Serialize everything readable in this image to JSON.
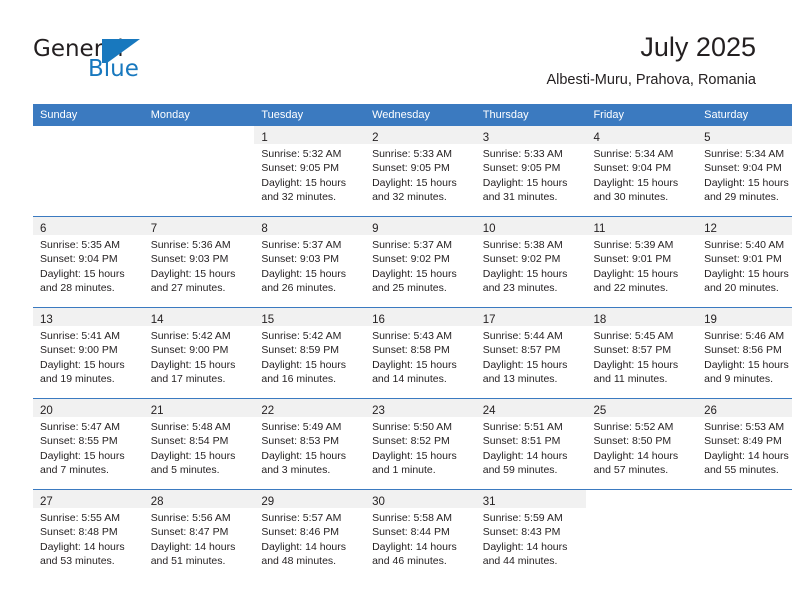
{
  "brand": {
    "word_one": "General",
    "word_two": "Blue",
    "flag_icon": "blue-flag-triangle",
    "colors": {
      "text": "#231f20",
      "blue": "#1878be"
    }
  },
  "header": {
    "title": "July 2025",
    "subtitle": "Albesti-Muru, Prahova, Romania"
  },
  "theme": {
    "header_blue": "#3b7ac0",
    "daynum_band": "#f1f1f1",
    "text": "#231f20"
  },
  "weekday_headers": [
    "Sunday",
    "Monday",
    "Tuesday",
    "Wednesday",
    "Thursday",
    "Friday",
    "Saturday"
  ],
  "weeks": [
    [
      {
        "day": ""
      },
      {
        "day": ""
      },
      {
        "day": "1",
        "sunrise": "Sunrise: 5:32 AM",
        "sunset": "Sunset: 9:05 PM",
        "daylight_l1": "Daylight: 15 hours",
        "daylight_l2": "and 32 minutes."
      },
      {
        "day": "2",
        "sunrise": "Sunrise: 5:33 AM",
        "sunset": "Sunset: 9:05 PM",
        "daylight_l1": "Daylight: 15 hours",
        "daylight_l2": "and 32 minutes."
      },
      {
        "day": "3",
        "sunrise": "Sunrise: 5:33 AM",
        "sunset": "Sunset: 9:05 PM",
        "daylight_l1": "Daylight: 15 hours",
        "daylight_l2": "and 31 minutes."
      },
      {
        "day": "4",
        "sunrise": "Sunrise: 5:34 AM",
        "sunset": "Sunset: 9:04 PM",
        "daylight_l1": "Daylight: 15 hours",
        "daylight_l2": "and 30 minutes."
      },
      {
        "day": "5",
        "sunrise": "Sunrise: 5:34 AM",
        "sunset": "Sunset: 9:04 PM",
        "daylight_l1": "Daylight: 15 hours",
        "daylight_l2": "and 29 minutes."
      }
    ],
    [
      {
        "day": "6",
        "sunrise": "Sunrise: 5:35 AM",
        "sunset": "Sunset: 9:04 PM",
        "daylight_l1": "Daylight: 15 hours",
        "daylight_l2": "and 28 minutes."
      },
      {
        "day": "7",
        "sunrise": "Sunrise: 5:36 AM",
        "sunset": "Sunset: 9:03 PM",
        "daylight_l1": "Daylight: 15 hours",
        "daylight_l2": "and 27 minutes."
      },
      {
        "day": "8",
        "sunrise": "Sunrise: 5:37 AM",
        "sunset": "Sunset: 9:03 PM",
        "daylight_l1": "Daylight: 15 hours",
        "daylight_l2": "and 26 minutes."
      },
      {
        "day": "9",
        "sunrise": "Sunrise: 5:37 AM",
        "sunset": "Sunset: 9:02 PM",
        "daylight_l1": "Daylight: 15 hours",
        "daylight_l2": "and 25 minutes."
      },
      {
        "day": "10",
        "sunrise": "Sunrise: 5:38 AM",
        "sunset": "Sunset: 9:02 PM",
        "daylight_l1": "Daylight: 15 hours",
        "daylight_l2": "and 23 minutes."
      },
      {
        "day": "11",
        "sunrise": "Sunrise: 5:39 AM",
        "sunset": "Sunset: 9:01 PM",
        "daylight_l1": "Daylight: 15 hours",
        "daylight_l2": "and 22 minutes."
      },
      {
        "day": "12",
        "sunrise": "Sunrise: 5:40 AM",
        "sunset": "Sunset: 9:01 PM",
        "daylight_l1": "Daylight: 15 hours",
        "daylight_l2": "and 20 minutes."
      }
    ],
    [
      {
        "day": "13",
        "sunrise": "Sunrise: 5:41 AM",
        "sunset": "Sunset: 9:00 PM",
        "daylight_l1": "Daylight: 15 hours",
        "daylight_l2": "and 19 minutes."
      },
      {
        "day": "14",
        "sunrise": "Sunrise: 5:42 AM",
        "sunset": "Sunset: 9:00 PM",
        "daylight_l1": "Daylight: 15 hours",
        "daylight_l2": "and 17 minutes."
      },
      {
        "day": "15",
        "sunrise": "Sunrise: 5:42 AM",
        "sunset": "Sunset: 8:59 PM",
        "daylight_l1": "Daylight: 15 hours",
        "daylight_l2": "and 16 minutes."
      },
      {
        "day": "16",
        "sunrise": "Sunrise: 5:43 AM",
        "sunset": "Sunset: 8:58 PM",
        "daylight_l1": "Daylight: 15 hours",
        "daylight_l2": "and 14 minutes."
      },
      {
        "day": "17",
        "sunrise": "Sunrise: 5:44 AM",
        "sunset": "Sunset: 8:57 PM",
        "daylight_l1": "Daylight: 15 hours",
        "daylight_l2": "and 13 minutes."
      },
      {
        "day": "18",
        "sunrise": "Sunrise: 5:45 AM",
        "sunset": "Sunset: 8:57 PM",
        "daylight_l1": "Daylight: 15 hours",
        "daylight_l2": "and 11 minutes."
      },
      {
        "day": "19",
        "sunrise": "Sunrise: 5:46 AM",
        "sunset": "Sunset: 8:56 PM",
        "daylight_l1": "Daylight: 15 hours",
        "daylight_l2": "and 9 minutes."
      }
    ],
    [
      {
        "day": "20",
        "sunrise": "Sunrise: 5:47 AM",
        "sunset": "Sunset: 8:55 PM",
        "daylight_l1": "Daylight: 15 hours",
        "daylight_l2": "and 7 minutes."
      },
      {
        "day": "21",
        "sunrise": "Sunrise: 5:48 AM",
        "sunset": "Sunset: 8:54 PM",
        "daylight_l1": "Daylight: 15 hours",
        "daylight_l2": "and 5 minutes."
      },
      {
        "day": "22",
        "sunrise": "Sunrise: 5:49 AM",
        "sunset": "Sunset: 8:53 PM",
        "daylight_l1": "Daylight: 15 hours",
        "daylight_l2": "and 3 minutes."
      },
      {
        "day": "23",
        "sunrise": "Sunrise: 5:50 AM",
        "sunset": "Sunset: 8:52 PM",
        "daylight_l1": "Daylight: 15 hours",
        "daylight_l2": "and 1 minute."
      },
      {
        "day": "24",
        "sunrise": "Sunrise: 5:51 AM",
        "sunset": "Sunset: 8:51 PM",
        "daylight_l1": "Daylight: 14 hours",
        "daylight_l2": "and 59 minutes."
      },
      {
        "day": "25",
        "sunrise": "Sunrise: 5:52 AM",
        "sunset": "Sunset: 8:50 PM",
        "daylight_l1": "Daylight: 14 hours",
        "daylight_l2": "and 57 minutes."
      },
      {
        "day": "26",
        "sunrise": "Sunrise: 5:53 AM",
        "sunset": "Sunset: 8:49 PM",
        "daylight_l1": "Daylight: 14 hours",
        "daylight_l2": "and 55 minutes."
      }
    ],
    [
      {
        "day": "27",
        "sunrise": "Sunrise: 5:55 AM",
        "sunset": "Sunset: 8:48 PM",
        "daylight_l1": "Daylight: 14 hours",
        "daylight_l2": "and 53 minutes."
      },
      {
        "day": "28",
        "sunrise": "Sunrise: 5:56 AM",
        "sunset": "Sunset: 8:47 PM",
        "daylight_l1": "Daylight: 14 hours",
        "daylight_l2": "and 51 minutes."
      },
      {
        "day": "29",
        "sunrise": "Sunrise: 5:57 AM",
        "sunset": "Sunset: 8:46 PM",
        "daylight_l1": "Daylight: 14 hours",
        "daylight_l2": "and 48 minutes."
      },
      {
        "day": "30",
        "sunrise": "Sunrise: 5:58 AM",
        "sunset": "Sunset: 8:44 PM",
        "daylight_l1": "Daylight: 14 hours",
        "daylight_l2": "and 46 minutes."
      },
      {
        "day": "31",
        "sunrise": "Sunrise: 5:59 AM",
        "sunset": "Sunset: 8:43 PM",
        "daylight_l1": "Daylight: 14 hours",
        "daylight_l2": "and 44 minutes."
      },
      {
        "day": ""
      },
      {
        "day": ""
      }
    ]
  ]
}
